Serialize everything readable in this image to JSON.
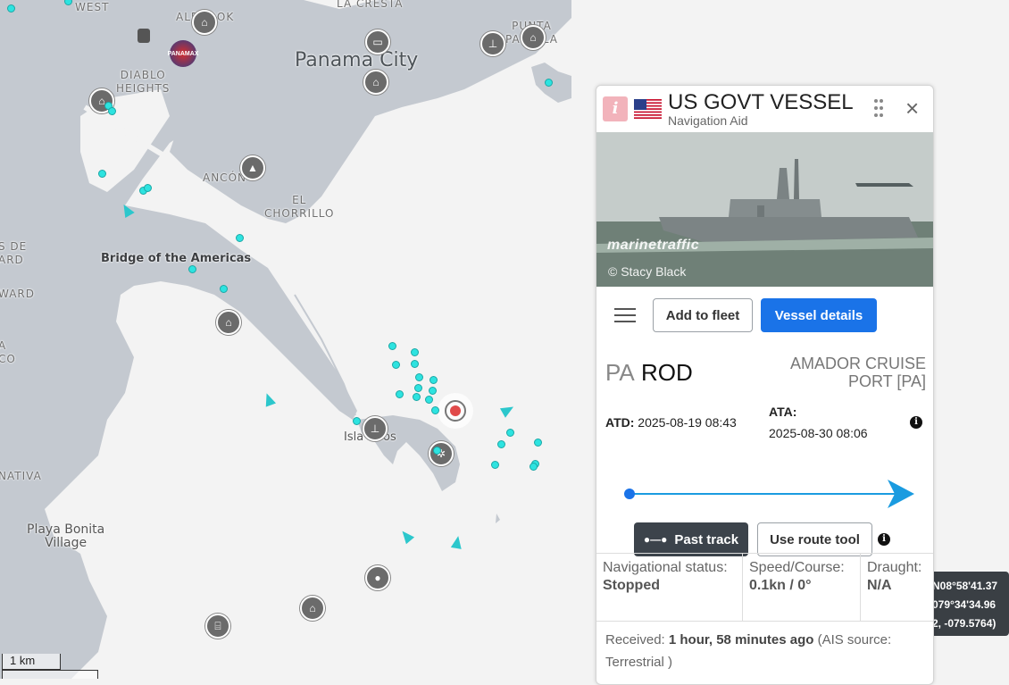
{
  "map": {
    "labels": {
      "west": "WEST",
      "albrook": "ALBROOK",
      "la_cresta": "LA CRESTA",
      "punta_paitilla": "PUNTA\nPAITILLA",
      "panama_city": "Panama City",
      "diablo_heights": "DIABLO\nHEIGHTS",
      "ancon": "ANCÓN",
      "el_chorrillo": "EL\nCHORRILLO",
      "bridge": "Bridge of the Americas",
      "left_de": "S DE\nARD",
      "left_ward": "WARD",
      "left_a_co": "A\nCO",
      "nativa": "NATIVA",
      "isla_naos": "Isla Naos",
      "playa_bonita": "Playa Bonita\nVillage"
    },
    "panamax_badge": "PANAMAX",
    "scale_label": "1 km",
    "coordinates": {
      "lat": "N08°58'41.37",
      "lon": "079°34'34.96",
      "decimal": "2, -079.5764)"
    }
  },
  "panel": {
    "info_badge": "i",
    "vessel_name": "US GOVT VESSEL",
    "vessel_type": "Navigation Aid",
    "close_icon": "×",
    "photo_watermark": "marinetraffic",
    "photo_credit": "© Stacy Black",
    "buttons": {
      "add_to_fleet": "Add to fleet",
      "vessel_details": "Vessel details",
      "past_track": "Past track",
      "use_route_tool": "Use route tool"
    },
    "departure": {
      "country_code": "PA",
      "port": "ROD"
    },
    "destination": "AMADOR CRUISE PORT [PA]",
    "atd_label": "ATD:",
    "atd_value": "2025-08-19 08:43",
    "ata_label": "ATA:",
    "ata_value": "2025-08-30 08:06",
    "route_progress": 1.0,
    "stats": {
      "nav_status_label": "Navigational status:",
      "nav_status_value": "Stopped",
      "speed_label": "Speed/Course:",
      "speed_value": "0.1kn / 0°",
      "draught_label": "Draught:",
      "draught_value": "N/A"
    },
    "received": {
      "label": "Received:",
      "value": "1 hour, 58 minutes ago",
      "source": "(AIS source: Terrestrial )"
    }
  },
  "colors": {
    "accent_blue": "#1a73e8",
    "route_line": "#1a9be0",
    "vessel_dot": "#2de3e0",
    "dark_button": "#3c434b",
    "info_badge": "#f2b3bb"
  }
}
